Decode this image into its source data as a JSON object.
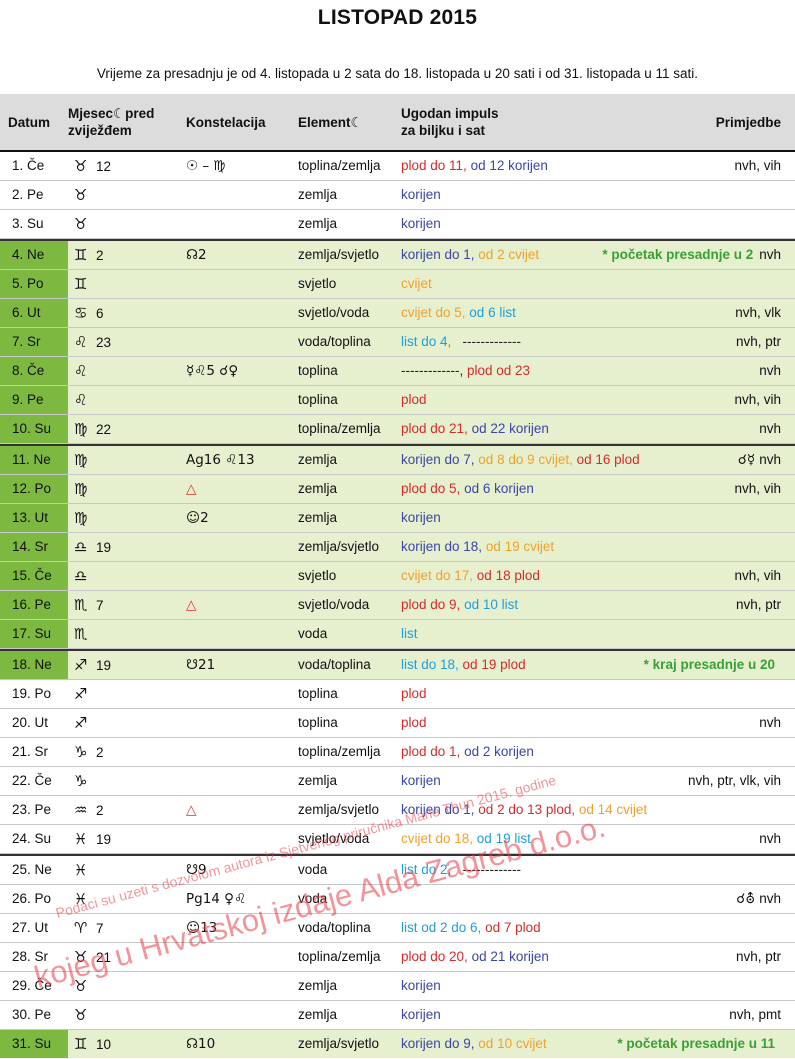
{
  "title": "LISTOPAD 2015",
  "intro": "Vrijeme za presadnju je od 4. listopada u 2 sata do 18. listopada u 20 sati i od 31. listopada u 11 sati.",
  "header": {
    "datum": "Datum",
    "mjesec1": "Mjesec☾pred",
    "mjesec2": "zviježđem",
    "konstelacija": "Konstelacija",
    "element": "Element☾",
    "impuls1": "Ugodan impuls",
    "impuls2": "za biljku i sat",
    "primjedbe": "Primjedbe"
  },
  "colors": {
    "plod": "#d52b2b",
    "korijen": "#3b46a5",
    "cvijet": "#f0a12a",
    "list": "#1f9ed8",
    "presadnja": "#3aa036",
    "green_band": "#e6f0cf",
    "green_date": "#7db941"
  },
  "rows": [
    {
      "date": "1. Če",
      "sign": "♉",
      "num": "12",
      "konst": "☉ – ♍",
      "elem": "toplina/zemlja",
      "imp": [
        {
          "t": "plod do 11, ",
          "c": "red"
        },
        {
          "t": "od 12 korijen",
          "c": "blue"
        }
      ],
      "note": "nvh, vih"
    },
    {
      "date": "2. Pe",
      "sign": "♉",
      "num": "",
      "konst": "",
      "elem": "zemlja",
      "imp": [
        {
          "t": "korijen",
          "c": "blue"
        }
      ],
      "note": ""
    },
    {
      "date": "3. Su",
      "sign": "♉",
      "num": "",
      "konst": "",
      "elem": "zemlja",
      "imp": [
        {
          "t": "korijen",
          "c": "blue"
        }
      ],
      "note": ""
    },
    {
      "date": "4. Ne",
      "sign": "♊",
      "num": "2",
      "konst": "☊2",
      "elem": "zemlja/svjetlo",
      "imp": [
        {
          "t": "korijen do 1, ",
          "c": "blue"
        },
        {
          "t": "od 2 cvijet",
          "c": "orange"
        }
      ],
      "pres": "* početak presadnje u 2",
      "note": "nvh",
      "green": true,
      "week": true
    },
    {
      "date": "5. Po",
      "sign": "♊",
      "num": "",
      "konst": "",
      "elem": "svjetlo",
      "imp": [
        {
          "t": "cvijet",
          "c": "orange"
        }
      ],
      "note": "",
      "green": true
    },
    {
      "date": "6. Ut",
      "sign": "♋",
      "num": "6",
      "konst": "",
      "elem": "svjetlo/voda",
      "imp": [
        {
          "t": "cvijet do 5, ",
          "c": "orange"
        },
        {
          "t": "od 6 list",
          "c": "cyan"
        }
      ],
      "note": "nvh, vlk",
      "green": true
    },
    {
      "date": "7. Sr",
      "sign": "♌",
      "num": "23",
      "konst": "",
      "elem": "voda/toplina",
      "imp": [
        {
          "t": "list do 4,",
          "c": "cyan"
        },
        {
          "t": "   -------------",
          "c": "dark"
        }
      ],
      "note": "nvh, ptr",
      "green": true
    },
    {
      "date": "8. Če",
      "sign": "♌",
      "num": "",
      "konst": "☿♌5  ☌♀",
      "elem": "toplina",
      "imp": [
        {
          "t": "-------------, ",
          "c": "dark"
        },
        {
          "t": "plod od 23",
          "c": "red"
        }
      ],
      "note": "nvh",
      "green": true
    },
    {
      "date": "9. Pe",
      "sign": "♌",
      "num": "",
      "konst": "",
      "elem": "toplina",
      "imp": [
        {
          "t": "plod",
          "c": "red"
        }
      ],
      "note": "nvh, vih",
      "green": true
    },
    {
      "date": "10. Su",
      "sign": "♍",
      "num": "22",
      "konst": "",
      "elem": "toplina/zemlja",
      "imp": [
        {
          "t": "plod do 21, ",
          "c": "red"
        },
        {
          "t": "od 22 korijen",
          "c": "blue"
        }
      ],
      "note": "nvh",
      "green": true
    },
    {
      "date": "11. Ne",
      "sign": "♍",
      "num": "",
      "konst": "Ag16  ♌13",
      "elem": "zemlja",
      "imp": [
        {
          "t": "korijen do 7, ",
          "c": "blue"
        },
        {
          "t": "od 8 do 9 cvijet, ",
          "c": "orange"
        },
        {
          "t": "od 16 plod",
          "c": "red"
        }
      ],
      "notesym": "☌☿",
      "note": "nvh",
      "green": true,
      "week": true
    },
    {
      "date": "12. Po",
      "sign": "♍",
      "num": "",
      "konst": "△",
      "tri": true,
      "elem": "zemlja",
      "imp": [
        {
          "t": "plod do 5, ",
          "c": "red"
        },
        {
          "t": "od 6 korijen",
          "c": "blue"
        }
      ],
      "note": "nvh, vih",
      "green": true
    },
    {
      "date": "13. Ut",
      "sign": "♍",
      "num": "",
      "konst": "☺2",
      "elem": "zemlja",
      "imp": [
        {
          "t": "korijen",
          "c": "blue"
        }
      ],
      "note": "",
      "green": true
    },
    {
      "date": "14. Sr",
      "sign": "♎",
      "num": "19",
      "konst": "",
      "elem": "zemlja/svjetlo",
      "imp": [
        {
          "t": "korijen do 18, ",
          "c": "blue"
        },
        {
          "t": "od 19 cvijet",
          "c": "orange"
        }
      ],
      "note": "",
      "green": true
    },
    {
      "date": "15. Če",
      "sign": "♎",
      "num": "",
      "konst": "",
      "elem": "svjetlo",
      "imp": [
        {
          "t": "cvijet do 17, ",
          "c": "orange"
        },
        {
          "t": "od 18 plod",
          "c": "red"
        }
      ],
      "note": "nvh, vih",
      "green": true
    },
    {
      "date": "16. Pe",
      "sign": "♏",
      "num": "7",
      "konst": "△",
      "tri": true,
      "elem": "svjetlo/voda",
      "imp": [
        {
          "t": "plod do 9, ",
          "c": "red"
        },
        {
          "t": "od 10 list",
          "c": "cyan"
        }
      ],
      "note": "nvh, ptr",
      "green": true
    },
    {
      "date": "17. Su",
      "sign": "♏",
      "num": "",
      "konst": "",
      "elem": "voda",
      "imp": [
        {
          "t": "list",
          "c": "cyan"
        }
      ],
      "note": "",
      "green": true
    },
    {
      "date": "18. Ne",
      "sign": "♐",
      "num": "19",
      "konst": "☋21",
      "elem": "voda/toplina",
      "imp": [
        {
          "t": "list do 18, ",
          "c": "cyan"
        },
        {
          "t": "od 19 plod",
          "c": "red"
        }
      ],
      "pres": "* kraj presadnje u 20",
      "note": "",
      "green": true,
      "week": true
    },
    {
      "date": "19. Po",
      "sign": "♐",
      "num": "",
      "konst": "",
      "elem": "toplina",
      "imp": [
        {
          "t": "plod",
          "c": "red"
        }
      ],
      "note": ""
    },
    {
      "date": "20. Ut",
      "sign": "♐",
      "num": "",
      "konst": "",
      "elem": "toplina",
      "imp": [
        {
          "t": "plod",
          "c": "red"
        }
      ],
      "note": "nvh"
    },
    {
      "date": "21. Sr",
      "sign": "♑",
      "num": "2",
      "konst": "",
      "elem": "toplina/zemlja",
      "imp": [
        {
          "t": "plod do 1, ",
          "c": "red"
        },
        {
          "t": "od 2 korijen",
          "c": "blue"
        }
      ],
      "note": ""
    },
    {
      "date": "22. Če",
      "sign": "♑",
      "num": "",
      "konst": "",
      "elem": "zemlja",
      "imp": [
        {
          "t": "korijen",
          "c": "blue"
        }
      ],
      "note": "nvh, ptr, vlk, vih"
    },
    {
      "date": "23. Pe",
      "sign": "♒",
      "num": "2",
      "konst": "△",
      "tri": true,
      "elem": "zemlja/svjetlo",
      "imp": [
        {
          "t": "korijen do 1, ",
          "c": "blue"
        },
        {
          "t": "od 2 do 13 plod, ",
          "c": "red"
        },
        {
          "t": "od 14 cvijet",
          "c": "orange"
        }
      ],
      "note": ""
    },
    {
      "date": "24. Su",
      "sign": "♓",
      "num": "19",
      "konst": "",
      "elem": "svjetlo/voda",
      "imp": [
        {
          "t": "cvijet do 18, ",
          "c": "orange"
        },
        {
          "t": "od 19 list",
          "c": "cyan"
        }
      ],
      "note": "nvh"
    },
    {
      "date": "25. Ne",
      "sign": "♓",
      "num": "",
      "konst": "☋9",
      "elem": "voda",
      "imp": [
        {
          "t": "list do 2,",
          "c": "cyan"
        },
        {
          "t": "   -------------",
          "c": "dark"
        }
      ],
      "note": "",
      "week": true
    },
    {
      "date": "26. Po",
      "sign": "♓",
      "num": "",
      "konst": "Pg14  ♀♌",
      "elem": "voda",
      "imp": [],
      "notesym": "☌⛢",
      "note": "nvh"
    },
    {
      "date": "27. Ut",
      "sign": "♈",
      "num": "7",
      "konst": "☺13",
      "elem": "voda/toplina",
      "imp": [
        {
          "t": "list od 2 do 6, ",
          "c": "cyan"
        },
        {
          "t": "od 7 plod",
          "c": "red"
        }
      ],
      "note": ""
    },
    {
      "date": "28. Sr",
      "sign": "♉",
      "num": "21",
      "konst": "",
      "elem": "toplina/zemlja",
      "imp": [
        {
          "t": "plod do 20, ",
          "c": "red"
        },
        {
          "t": "od 21 korijen",
          "c": "blue"
        }
      ],
      "note": "nvh, ptr"
    },
    {
      "date": "29. Če",
      "sign": "♉",
      "num": "",
      "konst": "",
      "elem": "zemlja",
      "imp": [
        {
          "t": "korijen",
          "c": "blue"
        }
      ],
      "note": ""
    },
    {
      "date": "30. Pe",
      "sign": "♉",
      "num": "",
      "konst": "",
      "elem": "zemlja",
      "imp": [
        {
          "t": "korijen",
          "c": "blue"
        }
      ],
      "note": "nvh, pmt"
    },
    {
      "date": "31. Su",
      "sign": "♊",
      "num": "10",
      "konst": "☊10",
      "elem": "zemlja/svjetlo",
      "imp": [
        {
          "t": "korijen do 9, ",
          "c": "blue"
        },
        {
          "t": "od 10 cvijet",
          "c": "orange"
        }
      ],
      "pres": "* početak presadnje u 11",
      "note": "",
      "green": true,
      "last": true
    }
  ],
  "watermark": {
    "line1": "Podaci su uzeti s dozvolom autora iz Sjetvenog priručnika Marie Thun 2015. godine",
    "line2": "kojeg u Hrvatskoj izdaje Alda Zagreb d.o.o."
  }
}
